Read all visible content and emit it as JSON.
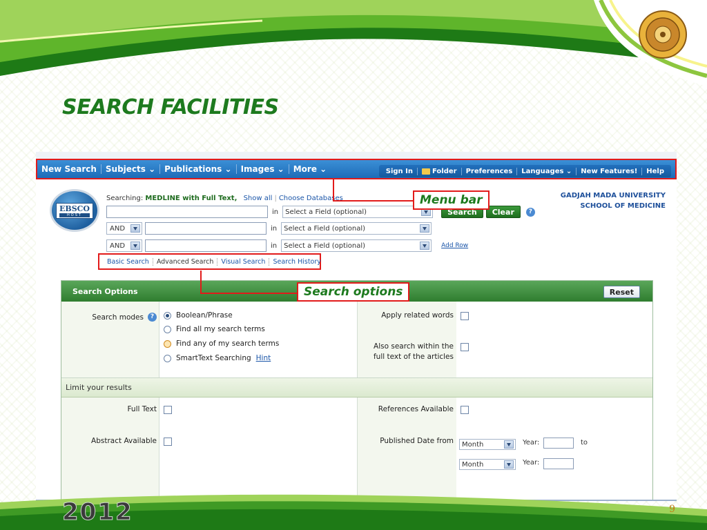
{
  "slide": {
    "title": "SEARCH FACILITIES",
    "year": "2012",
    "page_number": "9"
  },
  "callouts": {
    "menu_bar": "Menu bar",
    "search_options": "Search options"
  },
  "menubar": {
    "left_items": [
      "New Search",
      "Subjects ⌄",
      "Publications ⌄",
      "Images ⌄",
      "More ⌄"
    ],
    "right_items": [
      "Sign In",
      "Folder",
      "Preferences",
      "Languages ⌄",
      "New Features!",
      "Help"
    ]
  },
  "logo": {
    "line1": "EBSCO",
    "line2": "HOST"
  },
  "search": {
    "searching_label": "Searching:",
    "database": "MEDLINE with Full Text,",
    "show_all": "Show all",
    "choose_databases": "Choose Databases",
    "in_label": "in",
    "field_placeholder": "Select a Field (optional)",
    "bool_op": "AND",
    "search_button": "Search",
    "clear_button": "Clear",
    "add_row": "Add Row"
  },
  "institution": {
    "line1": "GADJAH MADA UNIVERSITY",
    "line2": "SCHOOL OF MEDICINE"
  },
  "tabs": [
    "Basic Search",
    "Advanced Search",
    "Visual Search",
    "Search History"
  ],
  "panel": {
    "title": "Search Options",
    "reset": "Reset",
    "search_modes_label": "Search modes",
    "modes": [
      "Boolean/Phrase",
      "Find all my search terms",
      "Find any of my search terms",
      "SmartText Searching"
    ],
    "hint": "Hint",
    "apply_related": "Apply related words",
    "also_search_1": "Also search within the",
    "also_search_2": "full text of the articles",
    "limit_title": "Limit your results",
    "full_text": "Full Text",
    "references": "References Available",
    "abstract": "Abstract Available",
    "published_date": "Published Date from",
    "month": "Month",
    "year_label": "Year:",
    "to_label": "to"
  },
  "colors": {
    "menu_blue": "#1d6cb8",
    "green_header": "#2f7d2f",
    "callout_red": "#e21a1a",
    "title_green": "#1d7a1e"
  }
}
